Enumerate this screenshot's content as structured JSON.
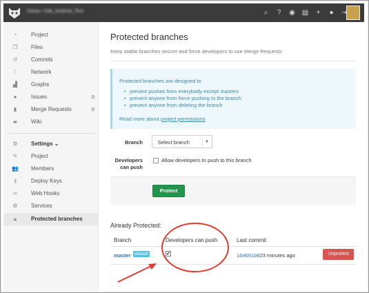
{
  "topbar": {
    "project_title": "Xiaoyi / Sdk_Android_Test",
    "icons": [
      "search-icon",
      "help-icon",
      "explore-icon",
      "snippets-icon",
      "add-icon",
      "profile-icon",
      "logout-icon"
    ]
  },
  "sidebar": {
    "items": [
      {
        "label": "Project",
        "icon": "dashboard-icon"
      },
      {
        "label": "Files",
        "icon": "files-icon"
      },
      {
        "label": "Commits",
        "icon": "history-icon"
      },
      {
        "label": "Network",
        "icon": "fork-icon"
      },
      {
        "label": "Graphs",
        "icon": "chart-icon"
      },
      {
        "label": "Issues",
        "icon": "issues-icon",
        "count": "0"
      },
      {
        "label": "Merge Requests",
        "icon": "merge-icon",
        "count": "0"
      },
      {
        "label": "Wiki",
        "icon": "book-icon"
      }
    ],
    "settings_label": "Settings ⌄",
    "settings_items": [
      {
        "label": "Project",
        "icon": "edit-icon"
      },
      {
        "label": "Members",
        "icon": "members-icon"
      },
      {
        "label": "Deploy Keys",
        "icon": "key-icon"
      },
      {
        "label": "Web Hooks",
        "icon": "link-icon"
      },
      {
        "label": "Services",
        "icon": "services-icon"
      },
      {
        "label": "Protected branches",
        "icon": "lock-icon",
        "active": true
      }
    ]
  },
  "main": {
    "title": "Protected branches",
    "subtitle": "Keep stable branches secure and force developers to use Merge Requests",
    "info": {
      "title": "Protected branches are designed to",
      "bullets": [
        "prevent pushes from everybody except masters",
        "prevent anyone from force pushing to the branch",
        "prevent anyone from deleting the branch"
      ],
      "more_text": "Read more about ",
      "more_link": "project permissions"
    },
    "form": {
      "branch_label": "Branch",
      "branch_select": "Select branch",
      "dev_label_line1": "Developers",
      "dev_label_line2": "can push",
      "dev_checkbox_label": "Allow developers to push to this branch",
      "protect_button": "Protect"
    },
    "protected": {
      "heading": "Already Protected:",
      "columns": [
        "Branch",
        "Developers can push",
        "Last commit"
      ],
      "rows": [
        {
          "branch": "master",
          "badge": "default",
          "dev_can_push": true,
          "commit_sha": "164691b8",
          "commit_time": "· 23 minutes ago",
          "action": "Unprotect"
        }
      ]
    }
  },
  "colors": {
    "topbar": "#3b3b3b",
    "protect": "#22944d",
    "unprotect": "#d9534f",
    "link": "#3172b8",
    "annotation": "#e03a2f"
  }
}
